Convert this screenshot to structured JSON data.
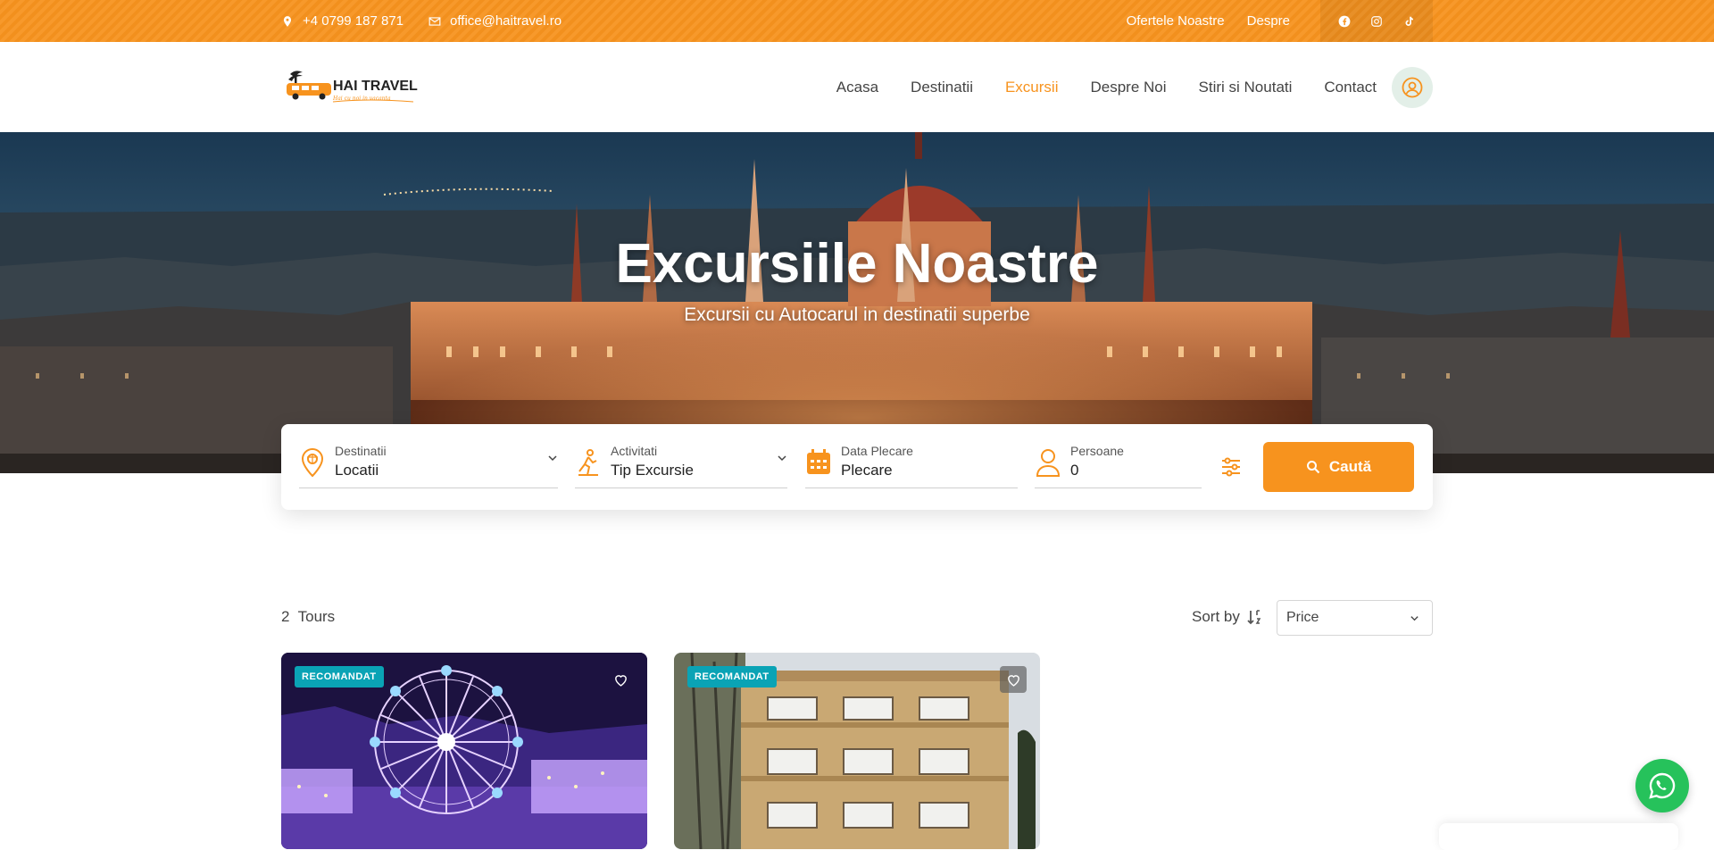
{
  "topbar": {
    "phone": "+4 0799 187 871",
    "email": "office@haitravel.ro",
    "links": [
      "Ofertele Noastre",
      "Despre"
    ],
    "social_icons": [
      "facebook-icon",
      "instagram-icon",
      "tiktok-icon"
    ]
  },
  "brand": {
    "name": "HAI TRAVEL",
    "tagline": "Hai cu noi in vacanta"
  },
  "nav": {
    "items": [
      "Acasa",
      "Destinatii",
      "Excursii",
      "Despre Noi",
      "Stiri si Noutati",
      "Contact"
    ],
    "active": "Excursii"
  },
  "hero": {
    "title": "Excursiile Noastre",
    "subtitle": "Excursii cu Autocarul in destinatii superbe"
  },
  "search": {
    "destination": {
      "label": "Destinatii",
      "value": "Locatii"
    },
    "activity": {
      "label": "Activitati",
      "value": "Tip Excursie"
    },
    "date": {
      "label": "Data Plecare",
      "value": "Plecare"
    },
    "persons": {
      "label": "Persoane",
      "value": "0"
    },
    "button": "Caută"
  },
  "results": {
    "count": "2",
    "count_label": "Tours",
    "sort_label": "Sort by",
    "sort_value": "Price"
  },
  "cards": [
    {
      "badge": "RECOMANDAT"
    },
    {
      "badge": "RECOMANDAT"
    }
  ],
  "colors": {
    "accent": "#f7931e",
    "badge": "#0aa3b5",
    "whatsapp": "#26c25b"
  }
}
